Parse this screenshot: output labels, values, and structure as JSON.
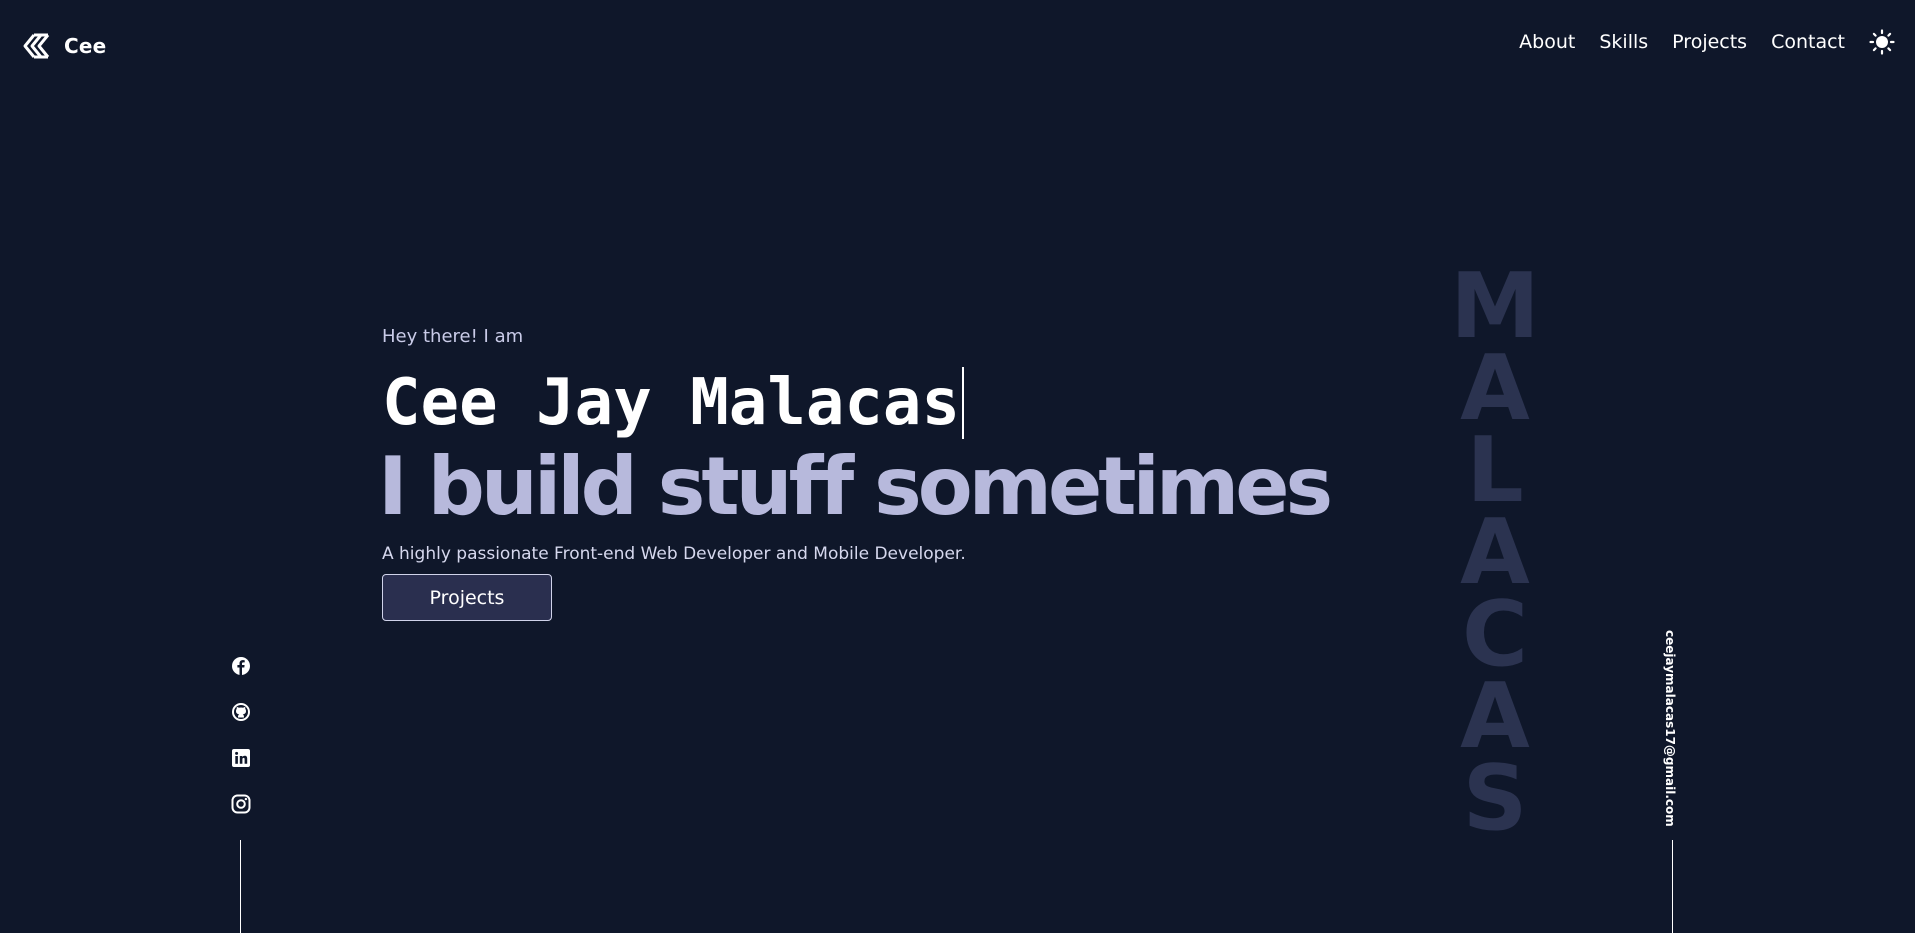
{
  "brand": {
    "name": "Cee",
    "logo_icon": "chevron-logo-icon"
  },
  "nav": {
    "items": [
      "About",
      "Skills",
      "Projects",
      "Contact"
    ],
    "theme_toggle_icon": "sun-icon"
  },
  "hero": {
    "greeting": "Hey there! I am",
    "name": "Cee Jay Malacas",
    "tagline": "I build stuff sometimes",
    "description": "A highly passionate Front-end Web Developer and Mobile Developer.",
    "cta_label": "Projects"
  },
  "socials": {
    "icons": [
      "facebook-icon",
      "github-icon",
      "linkedin-icon",
      "instagram-icon"
    ]
  },
  "decor": {
    "surname_letters": [
      "M",
      "A",
      "L",
      "A",
      "C",
      "A",
      "S"
    ]
  },
  "contact": {
    "email": "ceejaymalacas17@gmail.com"
  },
  "colors": {
    "background": "#0f172a",
    "accent": "#b7b9dc",
    "button_bg": "#2a2f4f",
    "surname": "#2b3350"
  }
}
